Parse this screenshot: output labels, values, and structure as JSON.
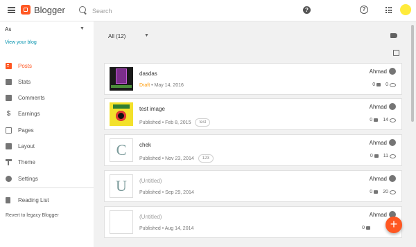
{
  "app": {
    "brand": "Blogger"
  },
  "search": {
    "placeholder": "Search"
  },
  "sidebar": {
    "blog_name": "As",
    "view_blog": "View your blog",
    "items": [
      {
        "label": "Posts",
        "icon": "posts-icon",
        "active": true
      },
      {
        "label": "Stats",
        "icon": "stats-icon"
      },
      {
        "label": "Comments",
        "icon": "comments-icon"
      },
      {
        "label": "Earnings",
        "icon": "earnings-icon"
      },
      {
        "label": "Pages",
        "icon": "pages-icon"
      },
      {
        "label": "Layout",
        "icon": "layout-icon"
      },
      {
        "label": "Theme",
        "icon": "theme-icon"
      },
      {
        "label": "Settings",
        "icon": "settings-icon"
      }
    ],
    "reading_list": "Reading List",
    "legacy": "Revert to legacy Blogger"
  },
  "filter": {
    "label": "All (12)"
  },
  "posts": [
    {
      "title": "dasdas",
      "status": "Draft",
      "date": "May 14, 2016",
      "label": "",
      "author": "Ahmad",
      "comments": "0",
      "views": "0"
    },
    {
      "title": "test image",
      "status": "Published",
      "date": "Feb 8, 2015",
      "label": "test",
      "author": "Ahmad",
      "comments": "0",
      "views": "14"
    },
    {
      "title": "chek",
      "status": "Published",
      "date": "Nov 23, 2014",
      "label": "123",
      "author": "Ahmad",
      "comments": "0",
      "views": "11",
      "thumb_letter": "C"
    },
    {
      "title": "(Untitled)",
      "status": "Published",
      "date": "Sep 29, 2014",
      "label": "",
      "author": "Ahmad",
      "comments": "0",
      "views": "20",
      "thumb_letter": "U"
    },
    {
      "title": "(Untitled)",
      "status": "Published",
      "date": "Aug 14, 2014",
      "label": "",
      "author": "Ahmad",
      "comments": "0",
      "views": ""
    }
  ],
  "fab": {
    "label": "+"
  },
  "colors": {
    "accent": "#ff5722",
    "link": "#0091ad",
    "draft": "#ff9800",
    "avatar": "#ffeb3b"
  }
}
